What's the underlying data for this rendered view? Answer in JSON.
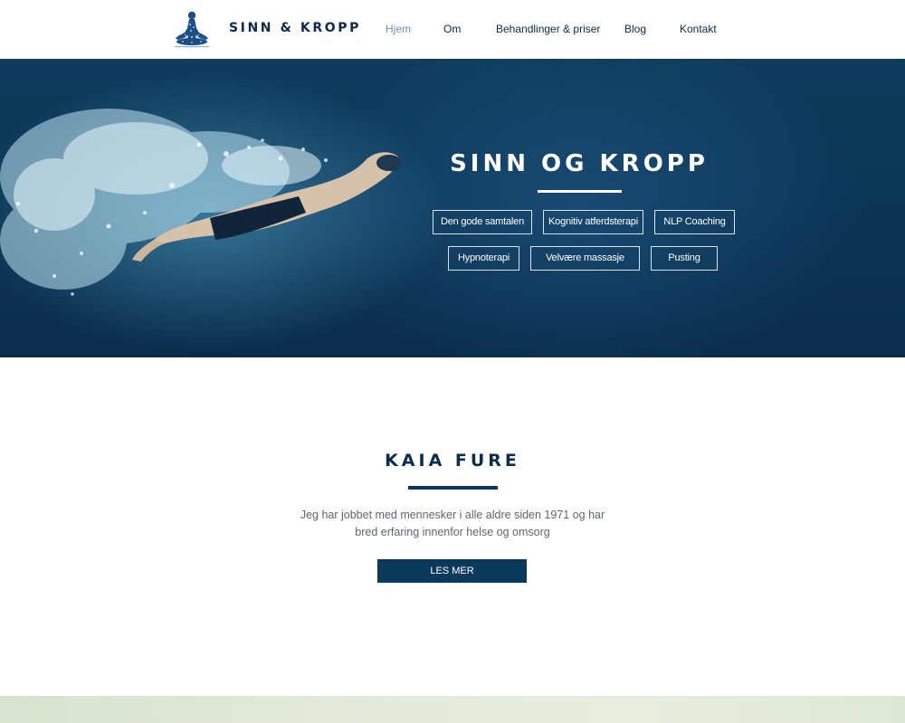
{
  "header": {
    "logo_text": "SINN & KROPP",
    "nav": [
      {
        "label": "Hjem",
        "active": true
      },
      {
        "label": "Om"
      },
      {
        "label": "Behandlinger & priser"
      },
      {
        "label": "Blog"
      },
      {
        "label": "Kontakt"
      }
    ]
  },
  "hero": {
    "title": "SINN OG KROPP",
    "services_row1": [
      "Den gode samtalen",
      "Kognitiv atferdsterapi",
      "NLP Coaching"
    ],
    "services_row2": [
      "Hypnoterapi",
      "Velvære massasje",
      "Pusting"
    ]
  },
  "about": {
    "title": "KAIA FURE",
    "text": "Jeg har jobbet med mennesker i alle aldre siden 1971 og har bred erfaring innenfor helse og omsorg",
    "button_label": "LES MER"
  },
  "colors": {
    "brand_navy": "#0b2c4a",
    "button_bg": "#0b3a5c",
    "nav_active": "#6f8ea8",
    "hero_bg": "#0c3656"
  }
}
